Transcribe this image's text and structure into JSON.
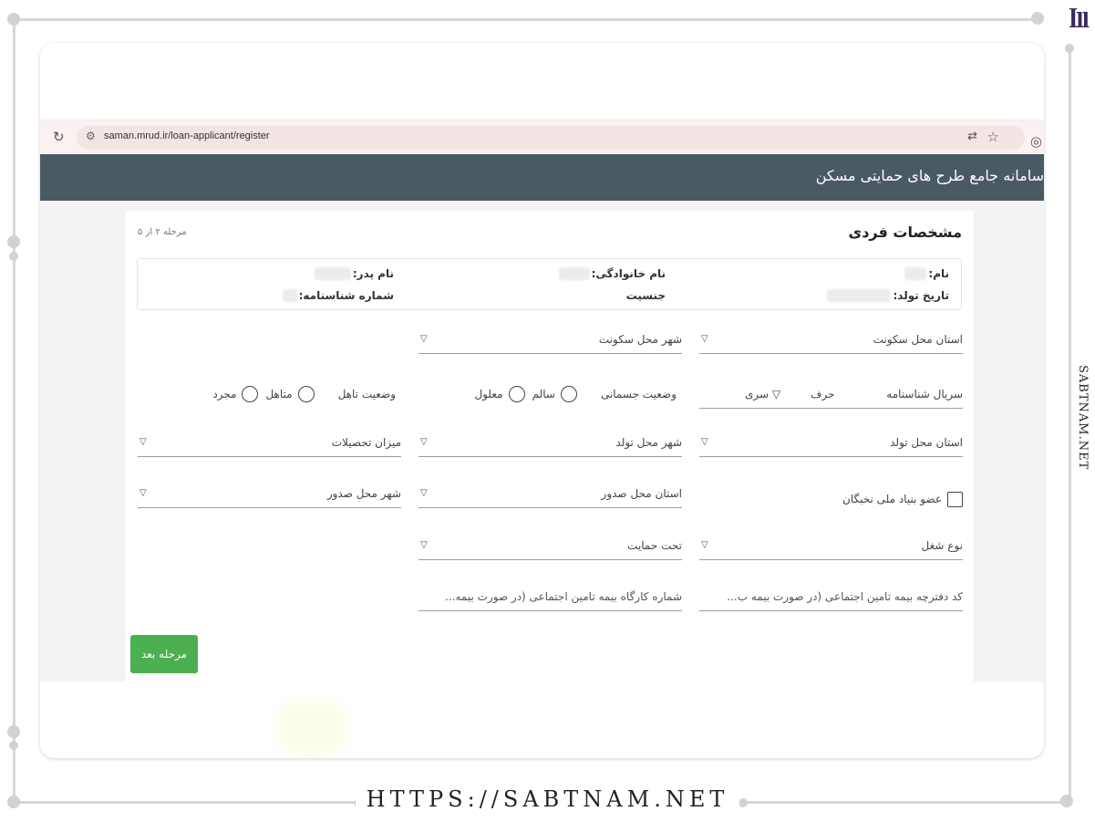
{
  "browser": {
    "url": "saman.mrud.ir/loan-applicant/register"
  },
  "app": {
    "title": "سامانه جامع طرح های حمایتی مسکن"
  },
  "form": {
    "section_title": "مشخصات فردی",
    "step": "مرحله ۲ از ۵",
    "info": {
      "first_name_label": "نام:",
      "last_name_label": "نام خانوادگی:",
      "father_name_label": "نام پدر:",
      "birth_date_label": "تاریخ تولد:",
      "gender_label": "جنسیت",
      "id_number_label": "شماره شناسنامه:"
    },
    "fields": {
      "residence_province": "استان محل سکونت",
      "residence_city": "شهر محل سکونت",
      "id_serial": "سریال شناسنامه",
      "id_serial_letter": "حرف",
      "id_serial_series": "سری",
      "physical_status": "وضعیت جسمانی",
      "physical_healthy": "سالم",
      "physical_disabled": "معلول",
      "marital_status": "وضعیت تاهل",
      "marital_married": "متاهل",
      "marital_single": "مجرد",
      "birth_province": "استان محل تولد",
      "birth_city": "شهر محل تولد",
      "education": "میزان تحصیلات",
      "elite_member": "عضو بنیاد ملی نخبگان",
      "issue_province": "استان محل صدور",
      "issue_city": "شهر محل صدور",
      "job_type": "نوع شغل",
      "under_support": "تحت حمایت",
      "insurance_code_placeholder": "کد دفترچه بیمه تامین اجتماعی (در صورت بیمه ب...",
      "workshop_number_placeholder": "شماره کارگاه بیمه تامین اجتماعی (در صورت بیمه..."
    },
    "next_button": "مرحله بعد"
  },
  "watermark": {
    "side_text": "SABTNAM.NET",
    "bottom_url": "HTTPS://SABTNAM.NET"
  },
  "icons": {
    "reload": "reload-icon",
    "site": "site-settings-icon",
    "translate": "translate-icon",
    "star": "bookmark-star-icon",
    "dropdown": "chevron-down-icon"
  }
}
